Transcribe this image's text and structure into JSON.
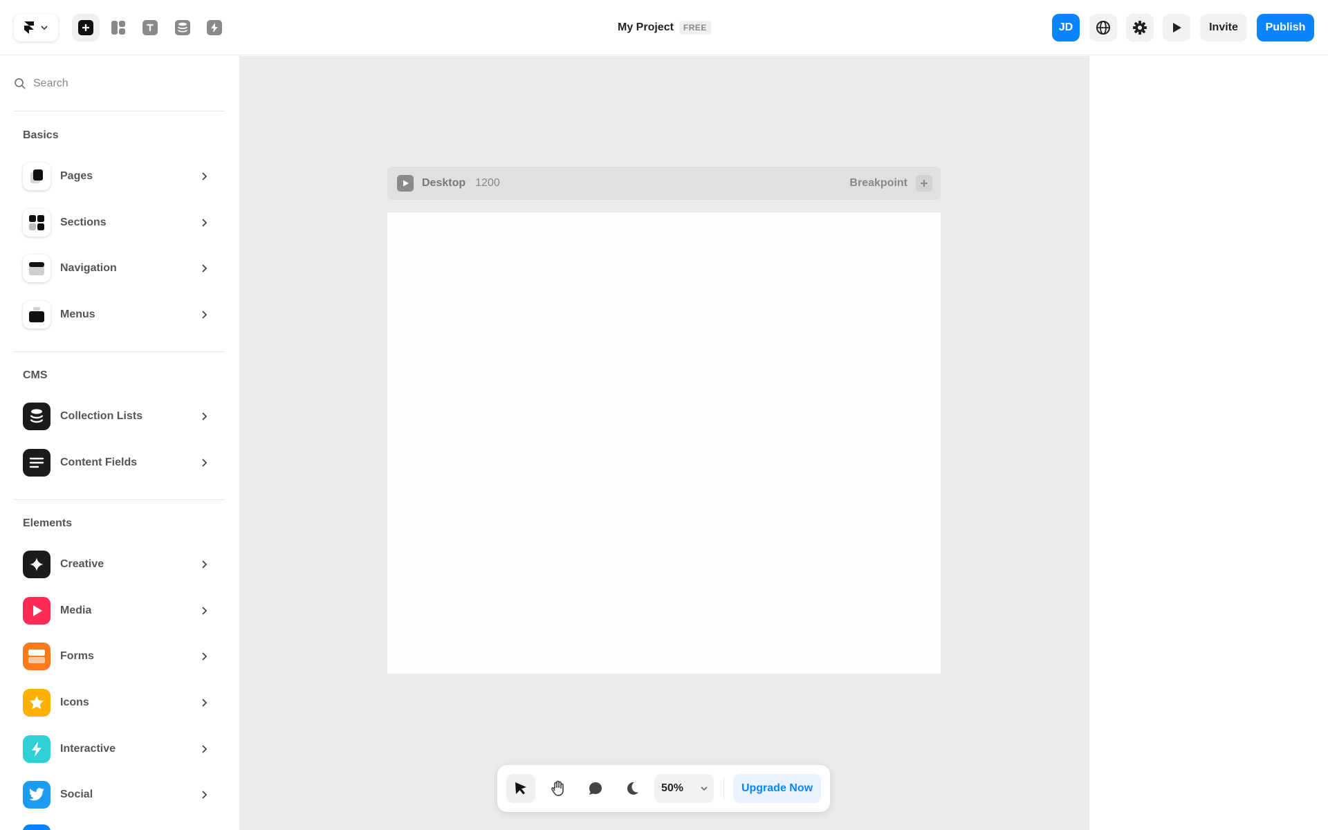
{
  "header": {
    "project_title": "My Project",
    "plan_badge": "FREE",
    "avatar_initials": "JD",
    "invite_label": "Invite",
    "publish_label": "Publish",
    "tools": [
      "insert-icon",
      "layout-icon",
      "text-icon",
      "cms-icon",
      "plugins-icon"
    ]
  },
  "sidebar": {
    "search_placeholder": "Search",
    "sections": [
      {
        "title": "Basics",
        "items": [
          {
            "label": "Pages",
            "icon": "page-icon"
          },
          {
            "label": "Sections",
            "icon": "sections-icon"
          },
          {
            "label": "Navigation",
            "icon": "navigation-icon"
          },
          {
            "label": "Menus",
            "icon": "menus-icon"
          }
        ]
      },
      {
        "title": "CMS",
        "items": [
          {
            "label": "Collection Lists",
            "icon": "database-icon"
          },
          {
            "label": "Content Fields",
            "icon": "lines-icon"
          }
        ]
      },
      {
        "title": "Elements",
        "items": [
          {
            "label": "Creative",
            "icon": "sparkle-icon"
          },
          {
            "label": "Media",
            "icon": "play-icon"
          },
          {
            "label": "Forms",
            "icon": "form-icon"
          },
          {
            "label": "Icons",
            "icon": "star-icon"
          },
          {
            "label": "Interactive",
            "icon": "bolt-icon"
          },
          {
            "label": "Social",
            "icon": "twitter-icon"
          }
        ]
      }
    ]
  },
  "canvas": {
    "breakpoint_name": "Desktop",
    "breakpoint_width": "1200",
    "breakpoint_label": "Breakpoint"
  },
  "bottom_toolbar": {
    "zoom": "50%",
    "upgrade_label": "Upgrade Now"
  },
  "colors": {
    "accent": "#0a84ff",
    "media": "#ff2d55",
    "forms": "#ff7a1a",
    "icons": "#ffb000",
    "interactive": "#2fd0d6",
    "social": "#1d9bf0"
  }
}
